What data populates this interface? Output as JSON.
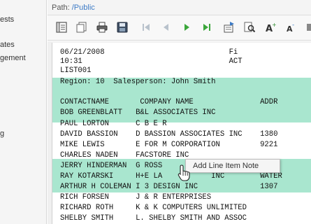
{
  "left_panel": {
    "items": [
      "ests",
      "ates",
      "gement",
      "g"
    ]
  },
  "path_bar": {
    "label": "Path:",
    "value": "/Public"
  },
  "toolbar": {
    "buttons": [
      {
        "name": "toc-icon"
      },
      {
        "name": "copy-pages-icon"
      },
      {
        "name": "print-icon"
      },
      {
        "name": "save-icon"
      },
      {
        "name": "first-page-icon"
      },
      {
        "name": "previous-page-icon"
      },
      {
        "name": "next-page-icon"
      },
      {
        "name": "last-page-icon"
      },
      {
        "name": "export-icon"
      },
      {
        "name": "search-icon"
      },
      {
        "name": "increase-font-icon"
      },
      {
        "name": "decrease-font-icon"
      },
      {
        "name": "more-icon"
      }
    ]
  },
  "report": {
    "lines": [
      {
        "text": "06/21/2008                            Fi",
        "hl": false
      },
      {
        "text": "10:31                                 ACT",
        "hl": false
      },
      {
        "text": "LIST001",
        "hl": false
      },
      {
        "text": "Region: 10  Salesperson: John Smith",
        "hl": true
      },
      {
        "text": "",
        "hl": true
      },
      {
        "text": "CONTACTNAME       COMPANY NAME               ADDR",
        "hl": true
      },
      {
        "text": "BOB GREENBLATT   B&L ASSOCIATES INC",
        "hl": true
      },
      {
        "text": "PAUL LORTON      C B E R",
        "hl": false
      },
      {
        "text": "DAVID BASSION    D BASSION ASSOCIATES INC    1380",
        "hl": false
      },
      {
        "text": "MIKE LEWIS       E FOR M CORPORATION         9221",
        "hl": false
      },
      {
        "text": "CHARLES NADEN    FACSTORE INC",
        "hl": false
      },
      {
        "text": "JERRY HINDERMAN  G ROSS",
        "hl": true
      },
      {
        "text": "RAY KOTARSKI     H+E LA           INC        WATER",
        "hl": true
      },
      {
        "text": "ARTHUR H COLEMAN I 3 DESIGN INC              1307",
        "hl": true
      },
      {
        "text": "RICH FORSEN      J & R ENTERPRISES",
        "hl": true
      },
      {
        "text": "RICHARD ROTH     K & K COMPUTERS UNLIMITED",
        "hl": false
      },
      {
        "text": "SHELBY SMITH     L. SHELBY SMITH AND ASSOC",
        "hl": false
      }
    ]
  },
  "context_tooltip": {
    "label": "Add Line Item Note"
  },
  "colors": {
    "highlight": "#a9e6cf",
    "path_link": "#3d7bc6",
    "nav_green": "#3aa63a"
  }
}
